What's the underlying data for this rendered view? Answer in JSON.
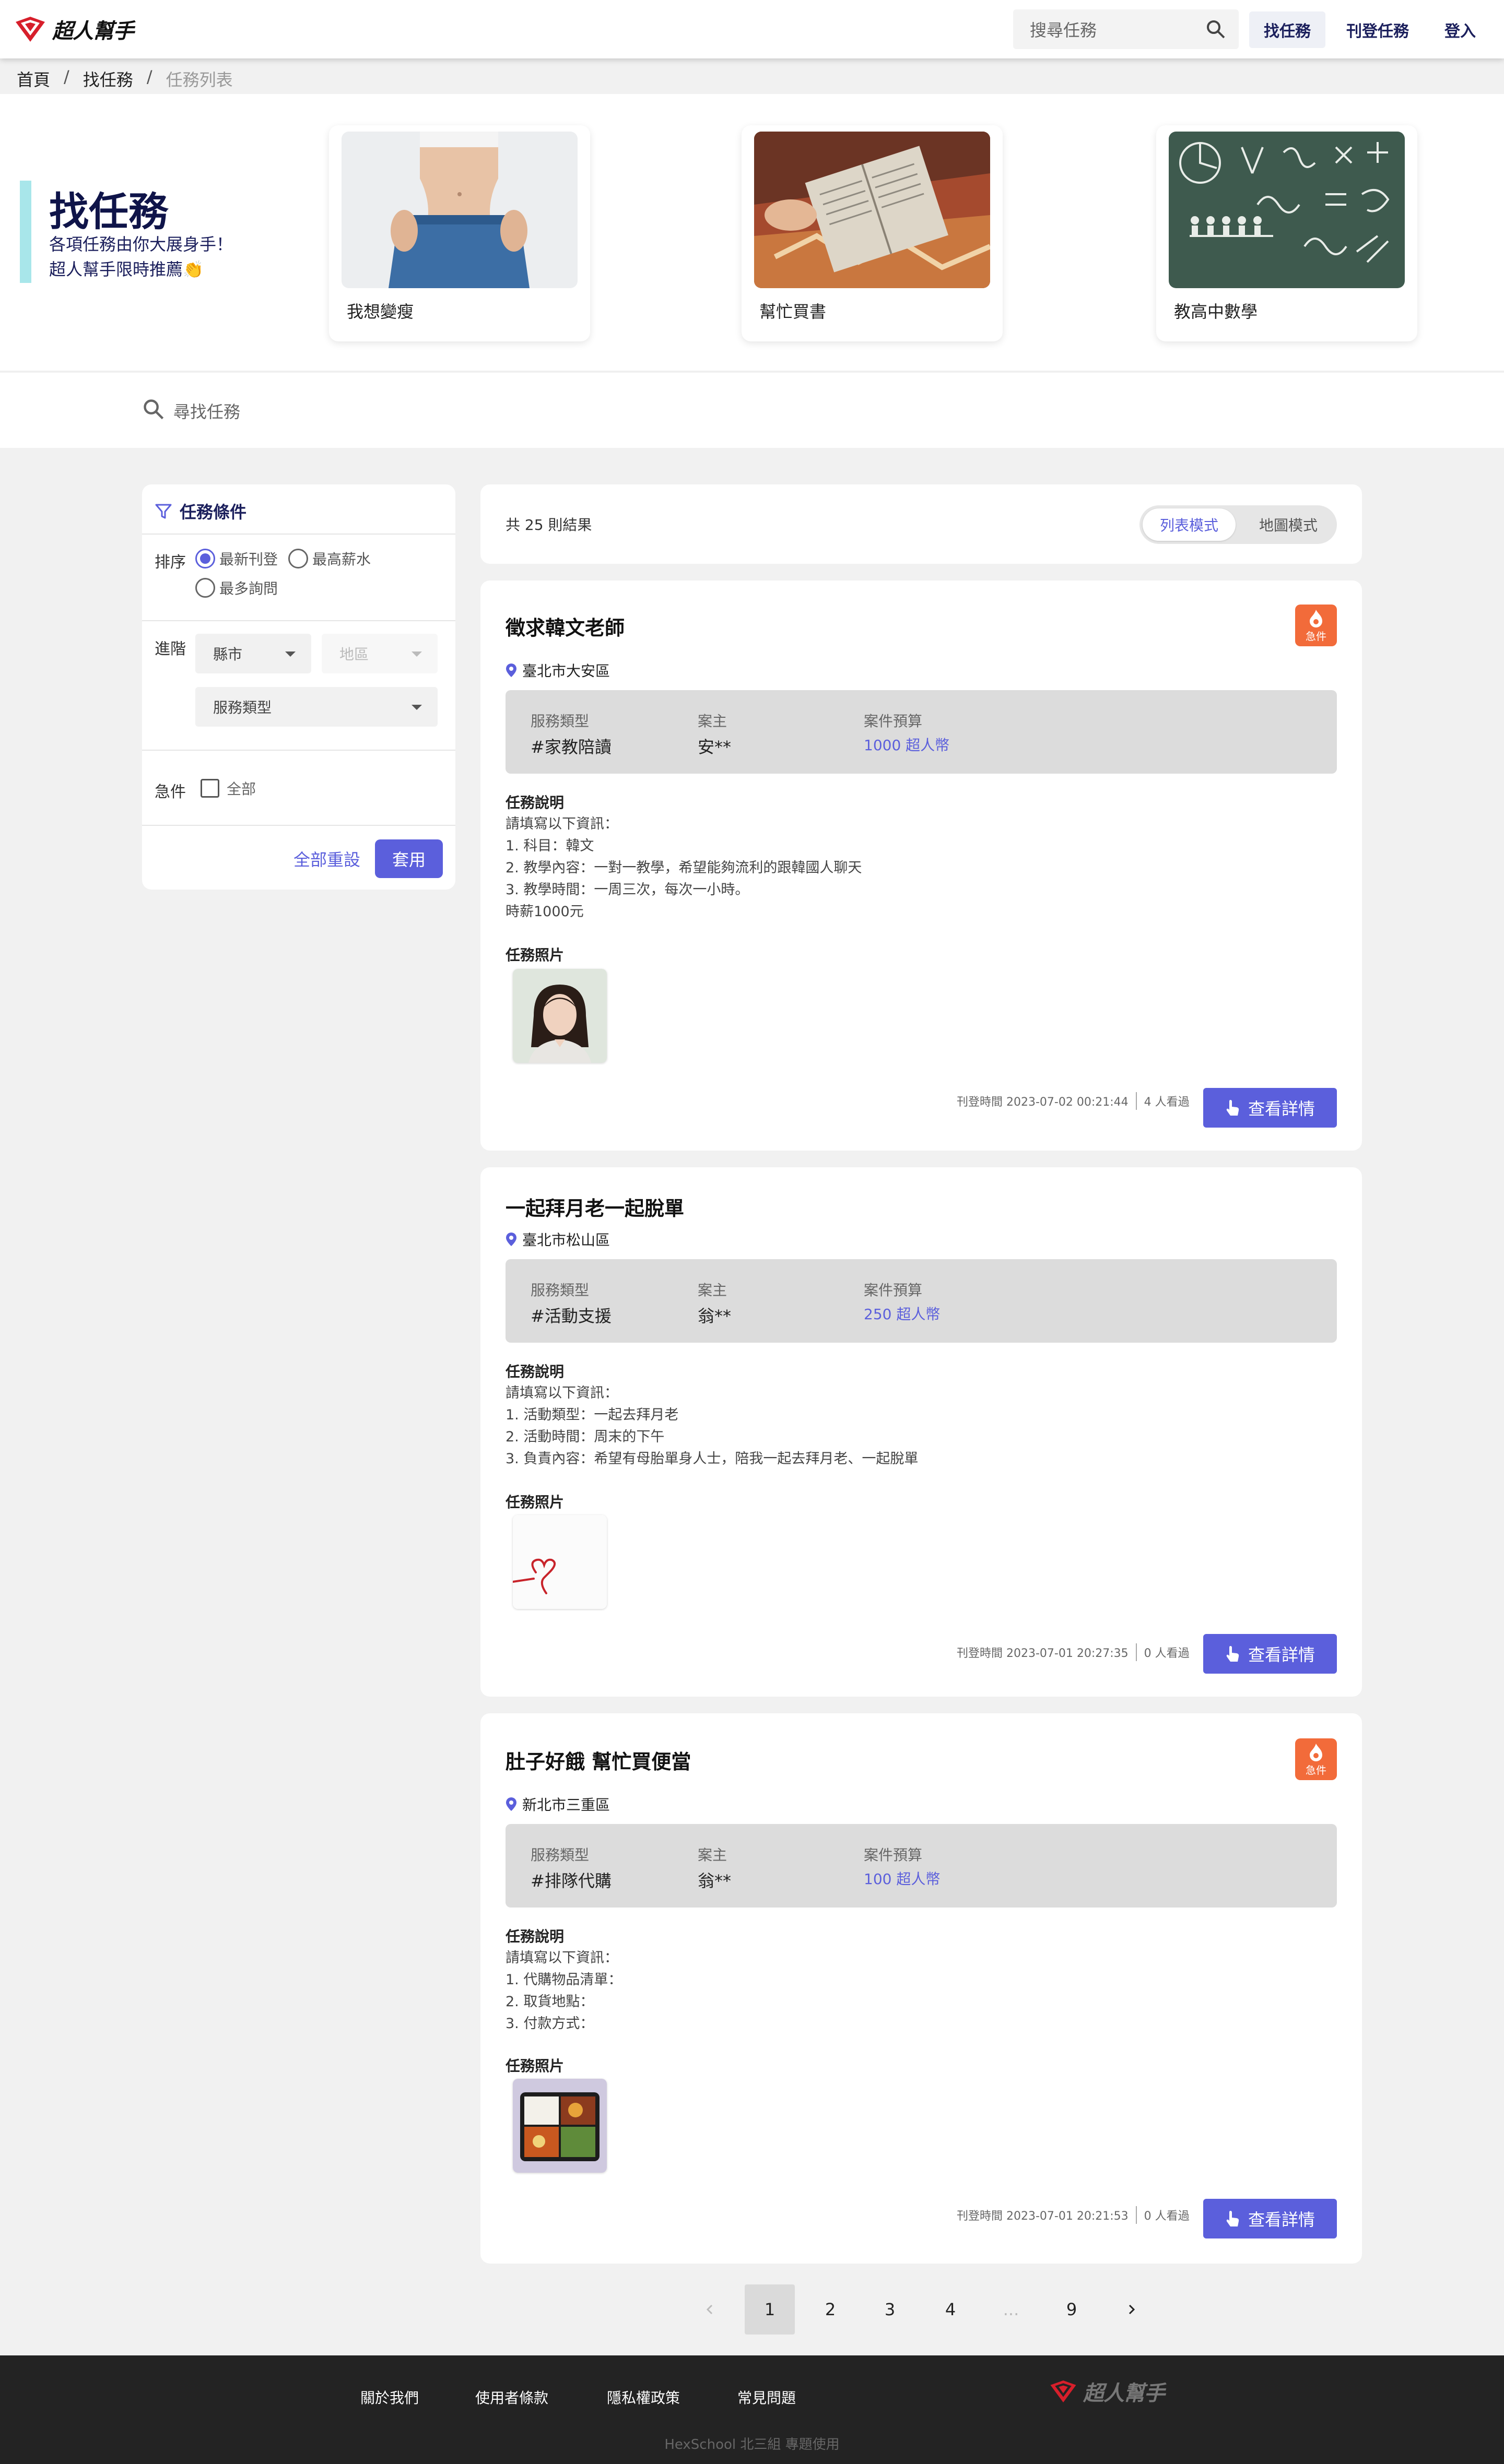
{
  "header": {
    "logo_text": "超人幫手",
    "search_placeholder": "搜尋任務",
    "nav": {
      "find": "找任務",
      "post": "刊登任務",
      "login": "登入"
    }
  },
  "breadcrumb": {
    "home": "首頁",
    "find": "找任務",
    "current": "任務列表",
    "sep": "/"
  },
  "hero": {
    "title": "找任務",
    "subtitle_1": "各項任務由你大展身手！",
    "subtitle_2": "超人幫手限時推薦👏",
    "cards": [
      {
        "label": "我想變瘦"
      },
      {
        "label": "幫忙買書"
      },
      {
        "label": "教高中數學"
      }
    ]
  },
  "search_strip": {
    "placeholder": "尋找任務"
  },
  "filter": {
    "title": "任務條件",
    "sort_label": "排序",
    "sort_options": [
      "最新刊登",
      "最高薪水",
      "最多詢問"
    ],
    "sort_selected": "最新刊登",
    "advanced_label": "進階",
    "city_placeholder": "縣市",
    "district_placeholder": "地區",
    "service_placeholder": "服務類型",
    "urgent_label": "急件",
    "urgent_option": "全部",
    "reset": "全部重設",
    "apply": "套用"
  },
  "results": {
    "count_text": "共 25 則結果",
    "mode_list": "列表模式",
    "mode_map": "地圖模式"
  },
  "labels": {
    "service_type": "服務類型",
    "owner": "案主",
    "budget": "案件預算",
    "description": "任務說明",
    "photos": "任務照片",
    "detail_button": "查看詳情",
    "urgent_badge": "急件"
  },
  "tasks": [
    {
      "title": "徵求韓文老師",
      "urgent": true,
      "location": "臺北市大安區",
      "service": "#家教陪讀",
      "owner": "安**",
      "budget": "1000 超人幣",
      "desc": [
        "請填寫以下資訊：",
        "1. 科目：韓文",
        "2. 教學內容：一對一教學，希望能夠流利的跟韓國人聊天",
        "3. 教學時間：一周三次，每次一小時。",
        "時薪1000元"
      ],
      "posted": "刊登時間 2023-07-02 00:21:44",
      "views": "4 人看過"
    },
    {
      "title": "一起拜月老一起脫單",
      "urgent": false,
      "location": "臺北市松山區",
      "service": "#活動支援",
      "owner": "翁**",
      "budget": "250 超人幣",
      "desc": [
        "請填寫以下資訊：",
        "1. 活動類型：一起去拜月老",
        "2. 活動時間：周末的下午",
        "3. 負責內容：希望有母胎單身人士，陪我一起去拜月老、一起脫單"
      ],
      "posted": "刊登時間 2023-07-01 20:27:35",
      "views": "0 人看過"
    },
    {
      "title": "肚子好餓 幫忙買便當",
      "urgent": true,
      "location": "新北市三重區",
      "service": "#排隊代購",
      "owner": "翁**",
      "budget": "100 超人幣",
      "desc": [
        "請填寫以下資訊：",
        "1. 代購物品清單：",
        "2. 取貨地點：",
        "3. 付款方式："
      ],
      "posted": "刊登時間 2023-07-01 20:21:53",
      "views": "0 人看過"
    }
  ],
  "pagination": {
    "pages": [
      "1",
      "2",
      "3",
      "4",
      "...",
      "9"
    ],
    "current": "1"
  },
  "footer": {
    "links": [
      "關於我們",
      "使用者條款",
      "隱私權政策",
      "常見問題"
    ],
    "logo_text": "超人幫手",
    "copyright": "HexSchool 北三組 專題使用"
  },
  "colors": {
    "primary": "#5b5fdc",
    "navy": "#0f1449",
    "urgent": "#f26b3a",
    "accent_bar": "#a8e6ea"
  }
}
